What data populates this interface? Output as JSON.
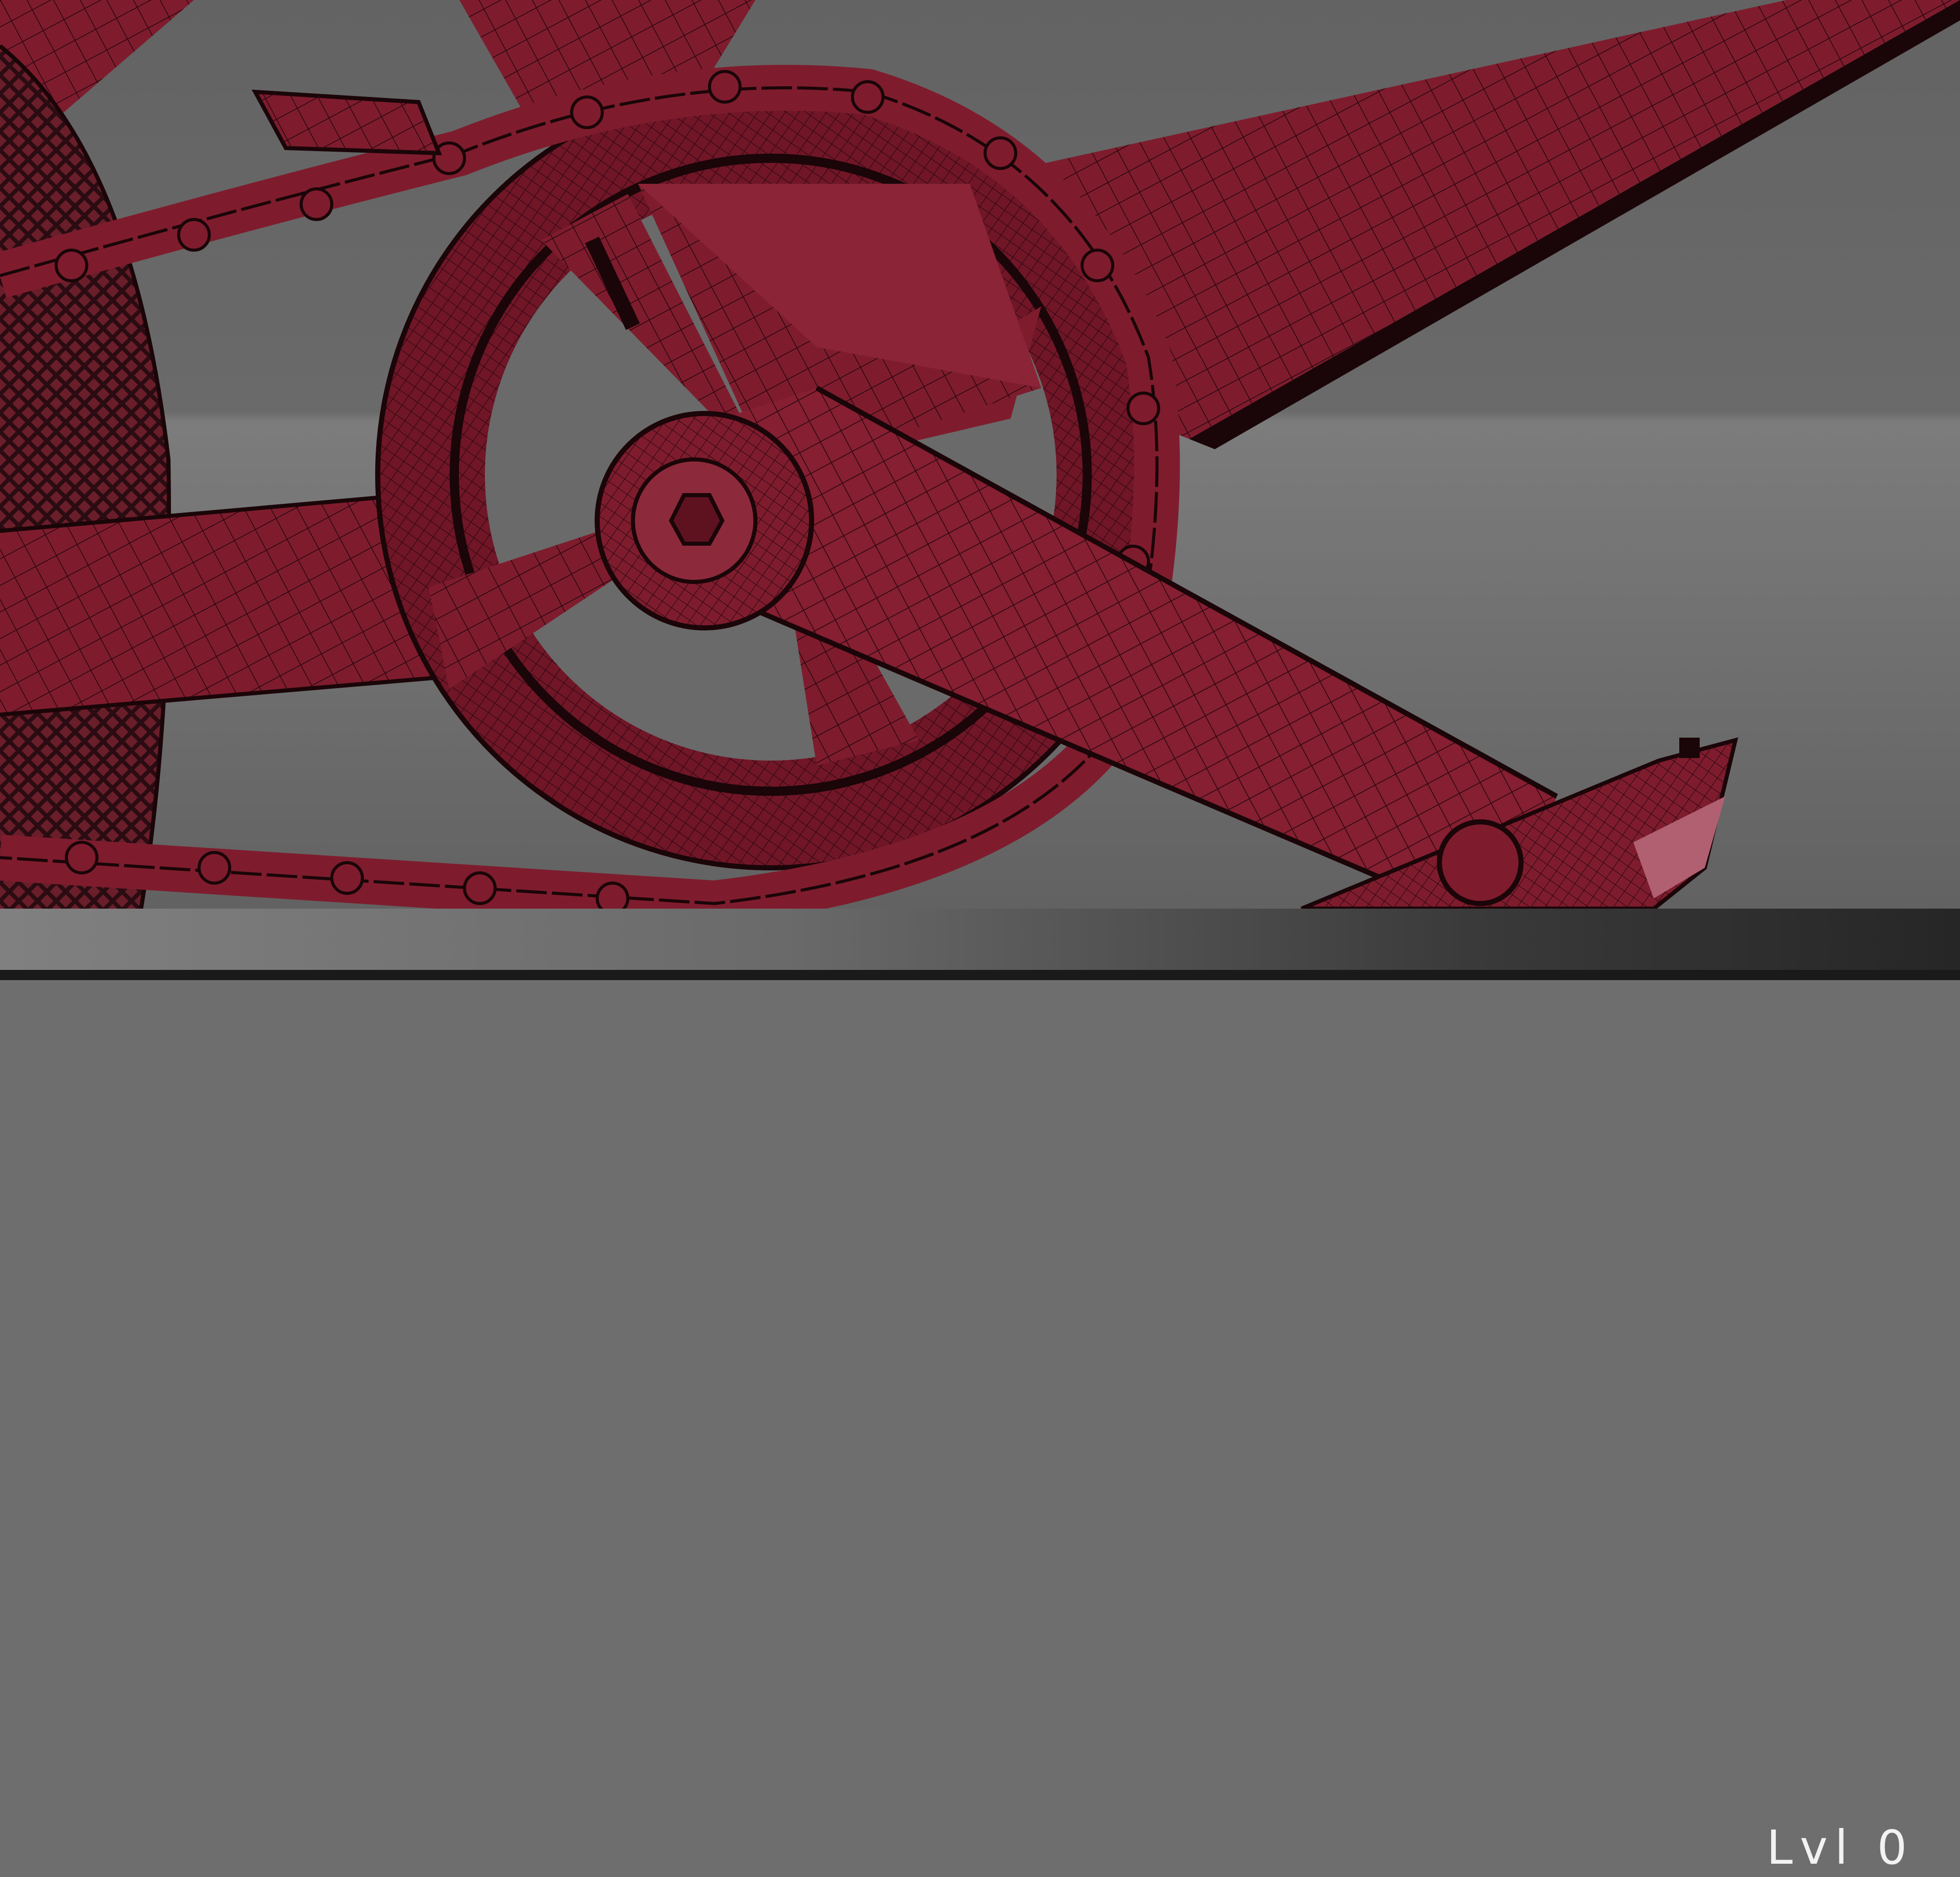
{
  "scene": {
    "subject": "bicycle-crankset-wireframe",
    "model_color": "#7a1a2b",
    "wire_color": "#1a0508",
    "background_color": "#6e6e6e"
  },
  "status_bar": {
    "lod_label": "Lvl 0"
  }
}
